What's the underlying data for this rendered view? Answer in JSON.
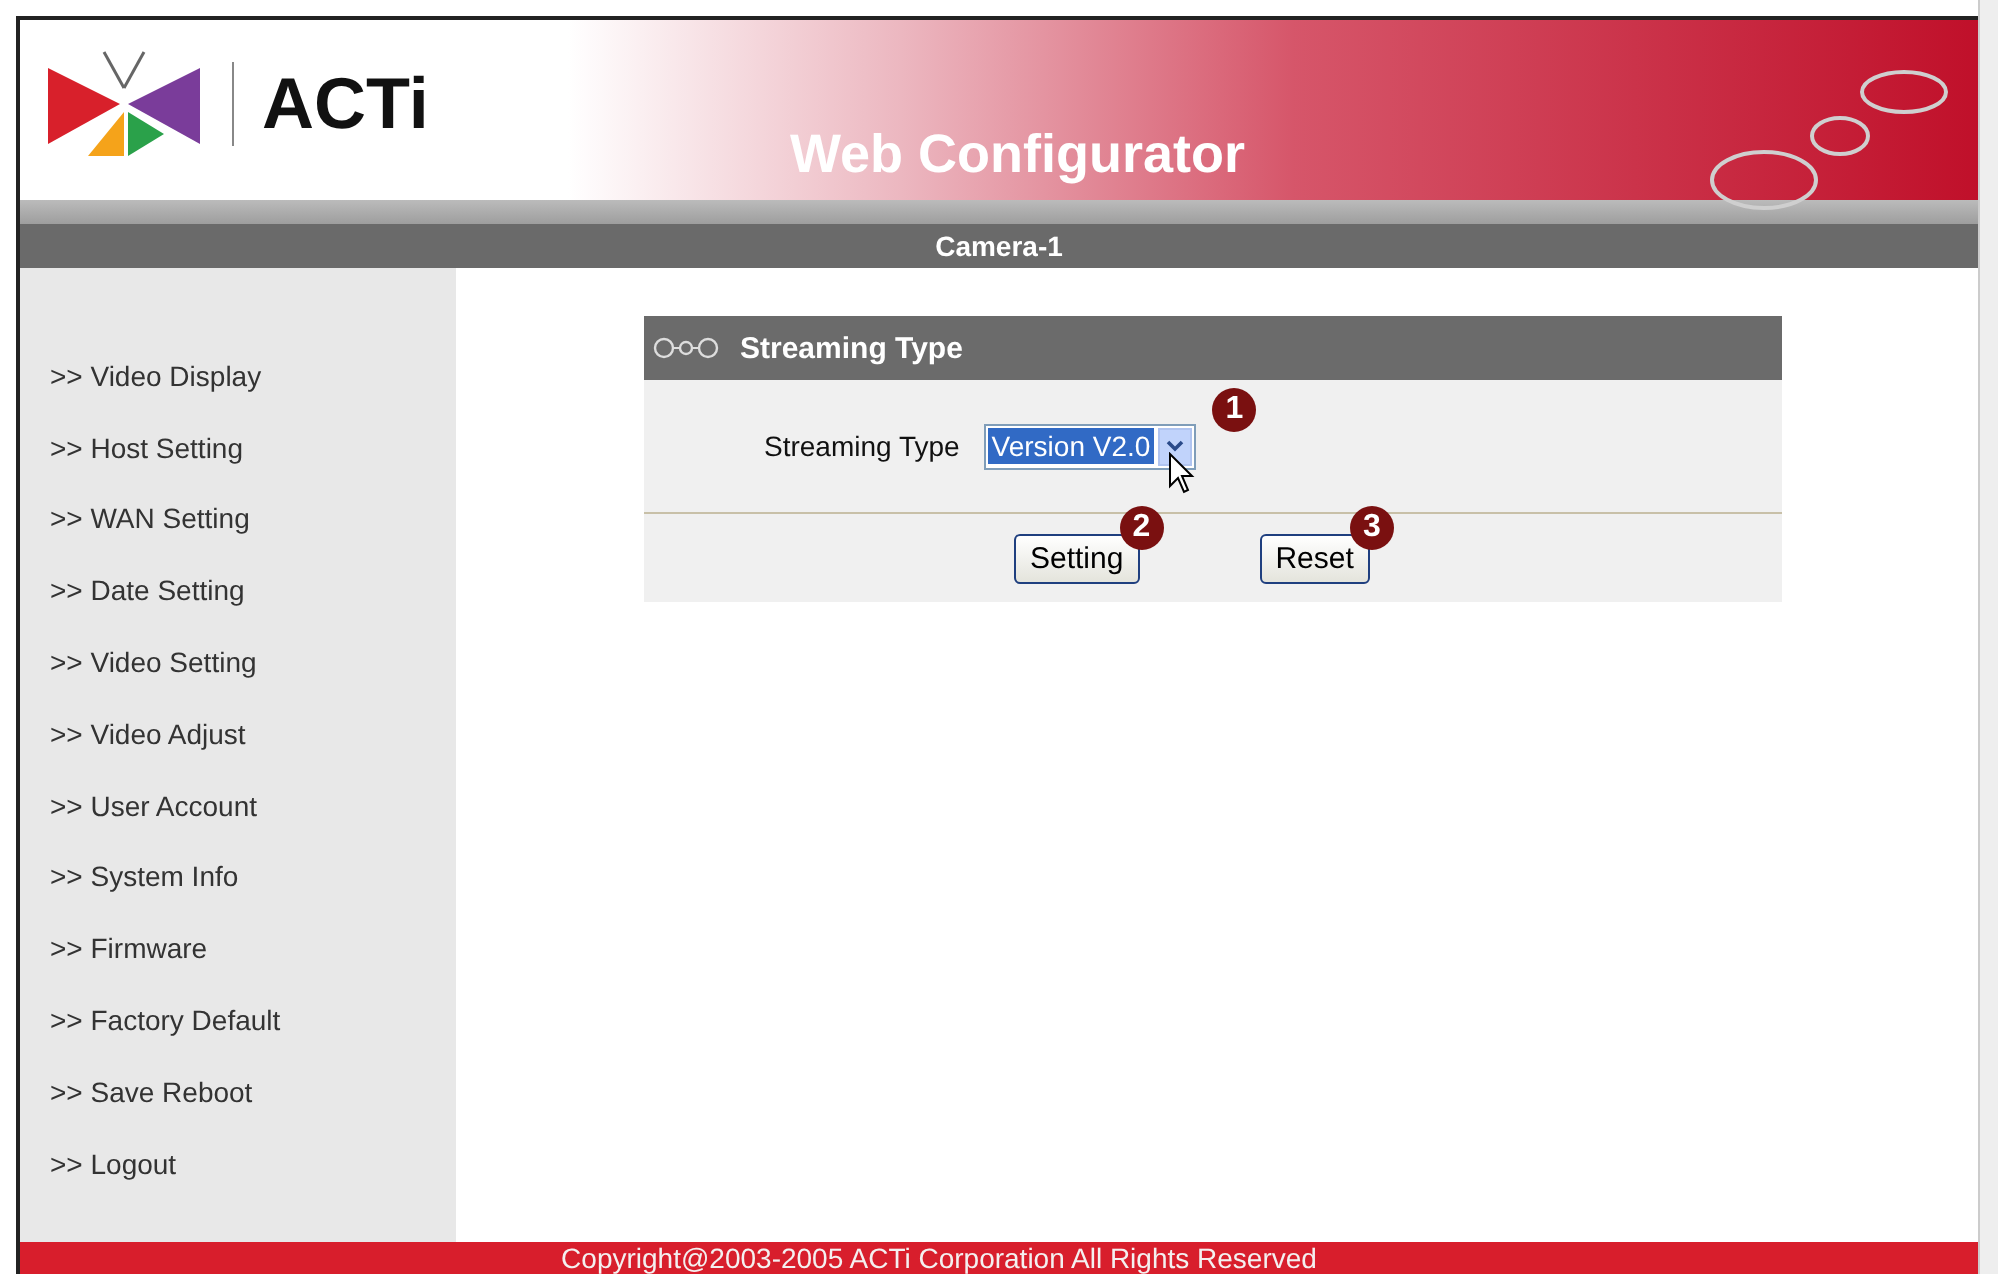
{
  "header": {
    "logo_text": "ACTi",
    "title": "Web Configurator"
  },
  "camera_bar": {
    "label": "Camera-1"
  },
  "sidebar": {
    "items": [
      {
        "label": ">> Video Display"
      },
      {
        "label": ">> Host Setting"
      },
      {
        "label": ">> WAN Setting"
      },
      {
        "label": ">> Date Setting"
      },
      {
        "label": ">> Video Setting"
      },
      {
        "label": ">> Video Adjust"
      },
      {
        "label": ">> User Account"
      },
      {
        "label": ">> System Info"
      },
      {
        "label": ">> Firmware"
      },
      {
        "label": ">> Factory Default"
      },
      {
        "label": ">> Save Reboot"
      },
      {
        "label": ">> Logout"
      }
    ]
  },
  "panel": {
    "title": "Streaming Type",
    "field_label": "Streaming Type",
    "select_value": "Version V2.0",
    "select_callout": "1",
    "buttons": [
      {
        "label": "Setting",
        "callout": "2"
      },
      {
        "label": "Reset",
        "callout": "3"
      }
    ]
  },
  "footer": {
    "text": "Copyright@2003-2005 ACTi Corporation All Rights Reserved"
  }
}
